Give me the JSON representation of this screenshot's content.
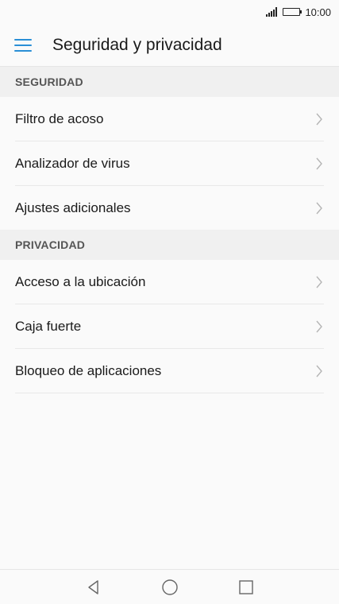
{
  "status_bar": {
    "time": "10:00"
  },
  "app_bar": {
    "title": "Seguridad y privacidad",
    "menu_icon": "hamburger-menu-icon",
    "accent_color": "#2a8fd6"
  },
  "sections": [
    {
      "header": "SEGURIDAD",
      "items": [
        {
          "label": "Filtro de acoso"
        },
        {
          "label": "Analizador de virus"
        },
        {
          "label": "Ajustes adicionales"
        }
      ]
    },
    {
      "header": "PRIVACIDAD",
      "items": [
        {
          "label": "Acceso a la ubicación"
        },
        {
          "label": "Caja fuerte"
        },
        {
          "label": "Bloqueo de aplicaciones"
        }
      ]
    }
  ],
  "nav_bar": {
    "icons": [
      "back-icon",
      "home-icon",
      "recents-icon"
    ]
  }
}
